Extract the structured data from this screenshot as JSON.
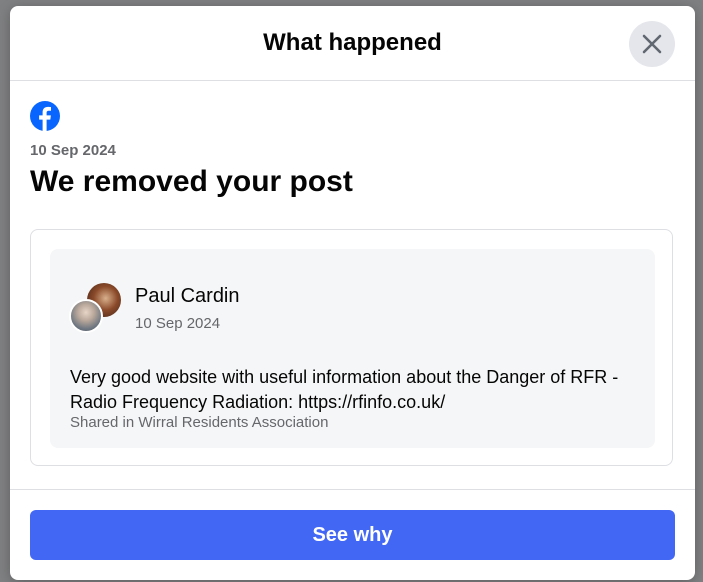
{
  "modal": {
    "title": "What happened",
    "close_icon": "close-icon"
  },
  "notice": {
    "logo_icon": "facebook-logo-icon",
    "date": "10 Sep 2024",
    "heading": "We removed your post"
  },
  "post": {
    "author": "Paul Cardin",
    "date": "10 Sep 2024",
    "text": "Very good website with useful information about the Danger of RFR - Radio Frequency Radiation: https://rfinfo.co.uk/",
    "shared_in": "Shared in Wirral Residents Association"
  },
  "footer": {
    "see_why_label": "See why"
  },
  "colors": {
    "brand_blue": "#4267f5",
    "facebook_blue": "#0866ff",
    "muted_text": "#65676b"
  }
}
